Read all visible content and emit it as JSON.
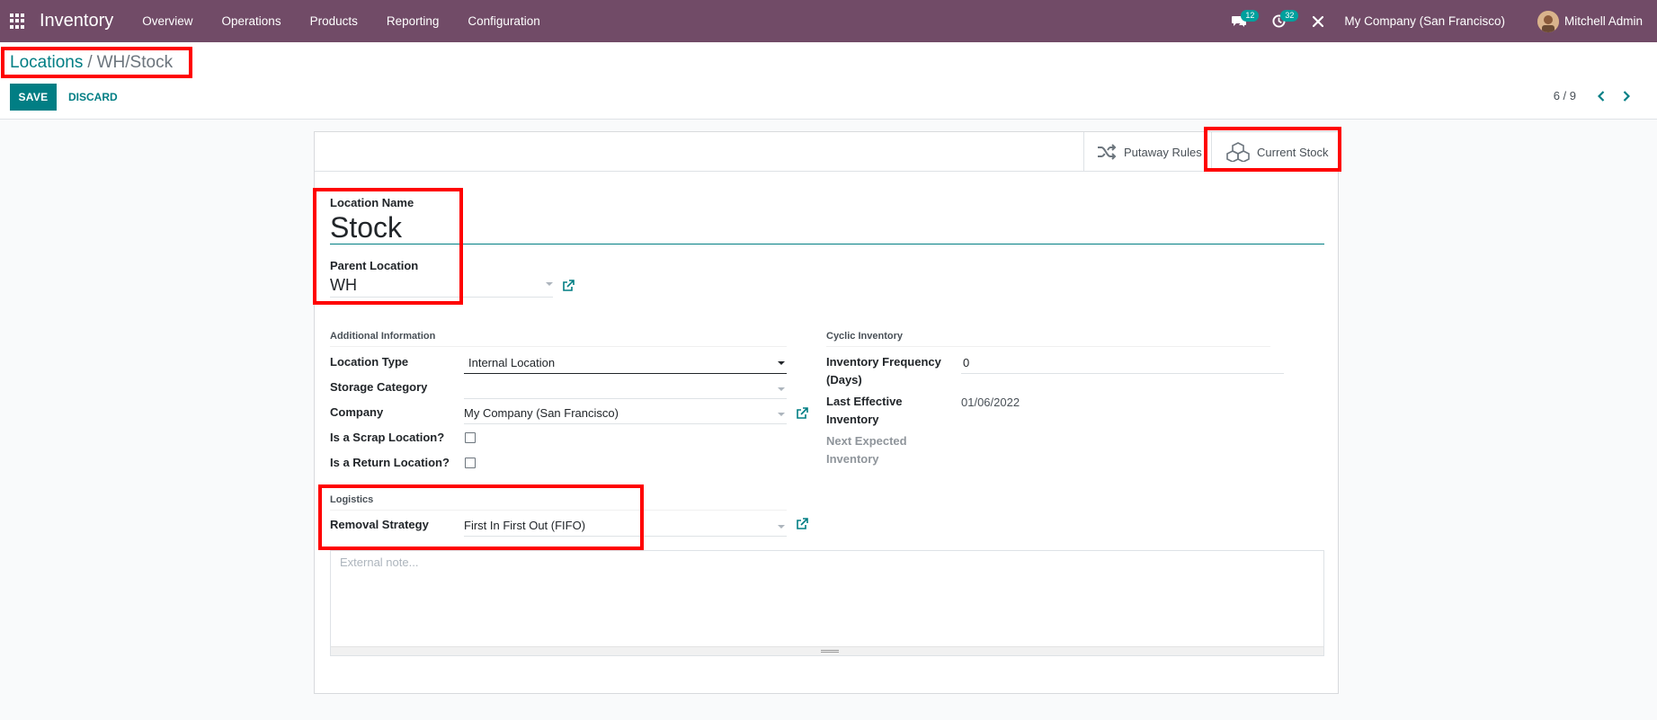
{
  "navbar": {
    "app_name": "Inventory",
    "menu": [
      "Overview",
      "Operations",
      "Products",
      "Reporting",
      "Configuration"
    ],
    "messages_count": "12",
    "activities_count": "32",
    "company": "My Company (San Francisco)",
    "user": "Mitchell Admin",
    "icons": [
      "apps-grid-icon",
      "chat-icon",
      "clock-icon",
      "tools-icon"
    ]
  },
  "breadcrumb": {
    "parent": "Locations",
    "separator": "/",
    "current": "WH/Stock"
  },
  "toolbar": {
    "save_label": "SAVE",
    "discard_label": "DISCARD"
  },
  "pager": {
    "value": "6 / 9"
  },
  "smart_buttons": {
    "putaway_rules": "Putaway Rules",
    "current_stock": "Current Stock"
  },
  "form": {
    "location_name_label": "Location Name",
    "location_name": "Stock",
    "parent_location_label": "Parent Location",
    "parent_location": "WH",
    "additional_info": {
      "title": "Additional Information",
      "location_type_label": "Location Type",
      "location_type": "Internal Location",
      "storage_category_label": "Storage Category",
      "storage_category": "",
      "company_label": "Company",
      "company": "My Company (San Francisco)",
      "scrap_label": "Is a Scrap Location?",
      "scrap_checked": false,
      "return_label": "Is a Return Location?",
      "return_checked": false
    },
    "cyclic_inventory": {
      "title": "Cyclic Inventory",
      "frequency_label_1": "Inventory Frequency",
      "frequency_label_2": "(Days)",
      "frequency": "0",
      "last_effective_label_1": "Last Effective",
      "last_effective_label_2": "Inventory",
      "last_effective": "01/06/2022",
      "next_expected_label_1": "Next Expected",
      "next_expected_label_2": "Inventory"
    },
    "logistics": {
      "title": "Logistics",
      "removal_strategy_label": "Removal Strategy",
      "removal_strategy": "First In First Out (FIFO)"
    },
    "note_placeholder": "External note..."
  },
  "colors": {
    "navbar": "#714b67",
    "primary": "#017e84",
    "highlight": "#ff0000"
  }
}
